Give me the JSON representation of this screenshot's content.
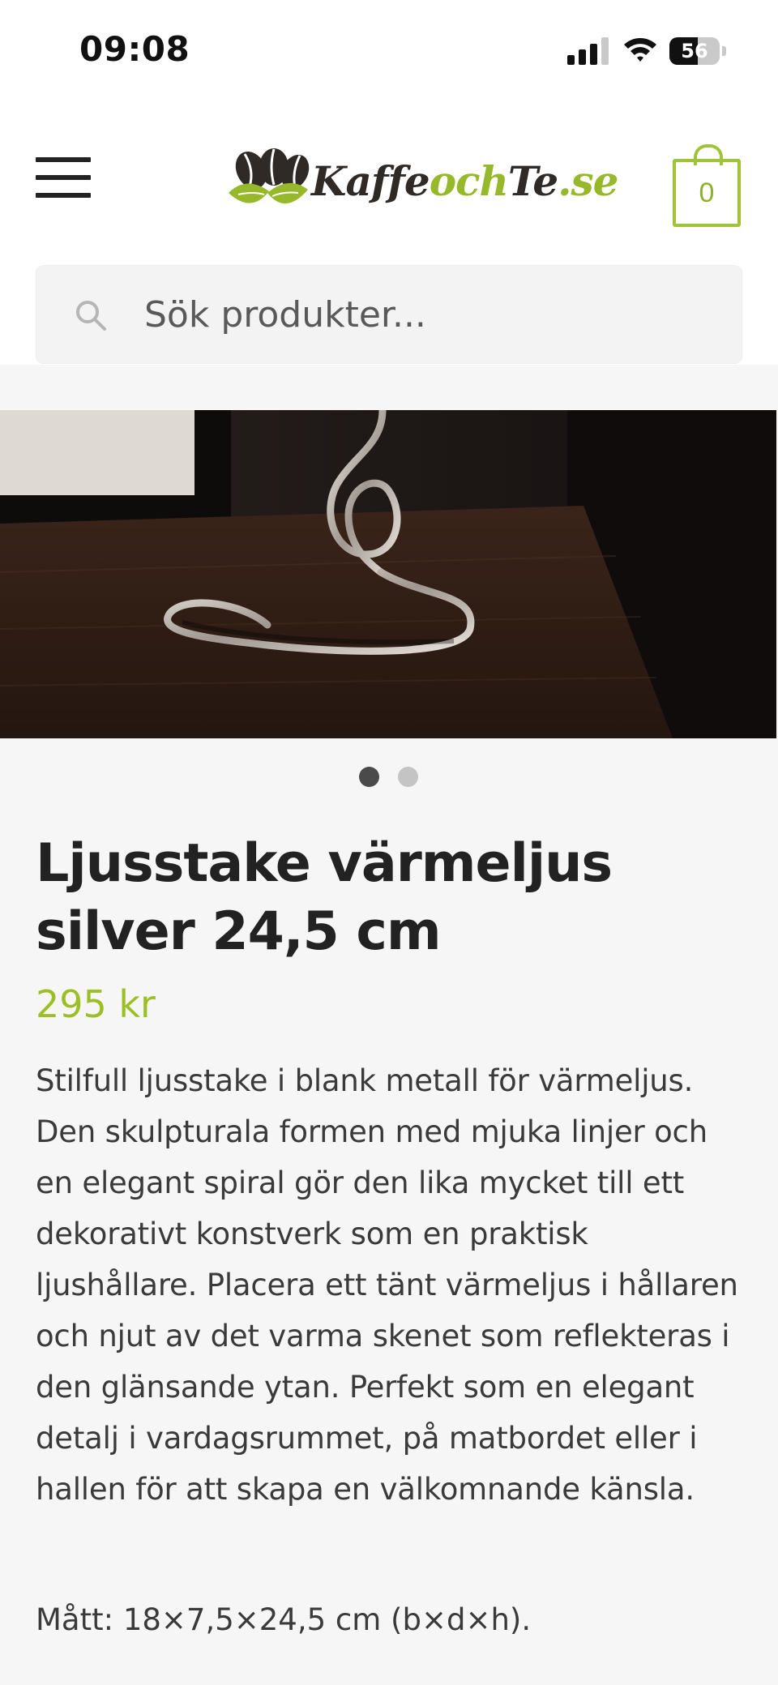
{
  "status_bar": {
    "time": "09:08",
    "battery_level": "56"
  },
  "header": {
    "logo_text_part1": "Kaffe",
    "logo_text_part2": "och",
    "logo_text_part3": "Te",
    "logo_text_part4": ".se",
    "cart_count": "0"
  },
  "search": {
    "placeholder": "Sök produkter..."
  },
  "carousel": {
    "slides": 2,
    "active_slide": 1
  },
  "product": {
    "title": "Ljusstake värmeljus silver 24,5 cm",
    "price": "295 kr",
    "description": "Stilfull ljusstake i blank metall för värmeljus. Den skulpturala formen med mjuka linjer och en elegant spiral gör den lika mycket till ett dekorativt konstverk som en praktisk ljushållare. Placera ett tänt värmeljus i hållaren och njut av det varma skenet som reflekteras i den glänsande ytan. Perfekt som en elegant detalj i vardagsrummet, på matbordet eller i hallen för att skapa en välkomnande känsla.",
    "dimensions": "Mått: 18×7,5×24,5 cm (b×d×h)."
  },
  "colors": {
    "brand_green": "#9dbf26",
    "brand_dark": "#2f2a26",
    "dot_active": "#4a4a4a",
    "dot_inactive": "#c4c4c4"
  }
}
